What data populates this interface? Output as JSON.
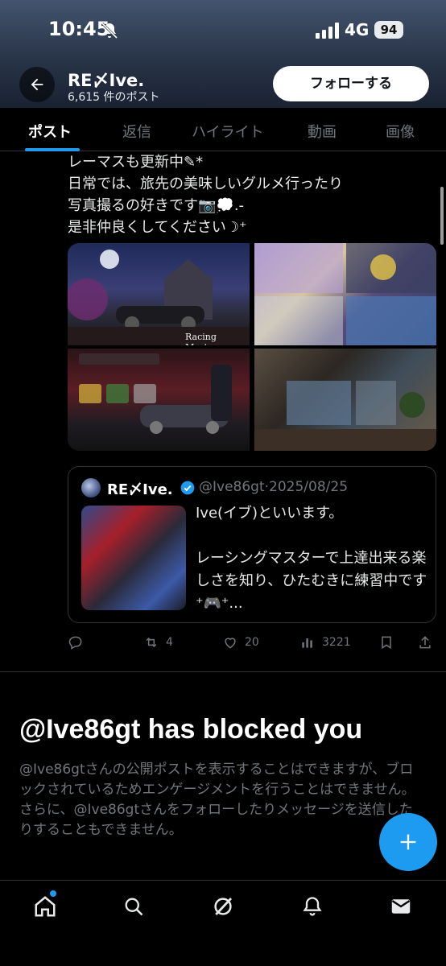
{
  "status_bar": {
    "time": "10:45",
    "network": "4G",
    "battery": "94"
  },
  "header": {
    "account_name": "RE〆Ive.",
    "post_count": "6,615 件のポスト",
    "follow_label": "フォローする"
  },
  "tabs": [
    {
      "label": "ポスト",
      "active": true
    },
    {
      "label": "返信"
    },
    {
      "label": "ハイライト"
    },
    {
      "label": "動画"
    },
    {
      "label": "画像"
    }
  ],
  "post": {
    "text_lines": [
      "レーマスも更新中✎*",
      "日常では、旅先の美味しいグルメ行ったり",
      "写真撮るの好きです📷💭.-",
      "是非仲良くしてください☽⁺"
    ],
    "image_label": "Racing Master"
  },
  "quote": {
    "name": "RE〆Ive.",
    "handle": "@Ive86gt·2025/08/25",
    "text": "Ive(イブ)といいます。\n\nレーシングマスターで上達出来る楽しさを知り、ひたむきに練習中です⁺🎮⁺..."
  },
  "actions": {
    "reply": "",
    "repost": "4",
    "like": "20",
    "views": "3221"
  },
  "blocked": {
    "title": "@Ive86gt has blocked you",
    "description": "@Ive86gtさんの公開ポストを表示することはできますが、ブロックされているためエンゲージメントを行うことはできません。さらに、@Ive86gtさんをフォローしたりメッセージを送信したりすることもできません。"
  },
  "colors": {
    "accent": "#1d9bf0",
    "muted": "#71767b",
    "background": "#000000"
  }
}
